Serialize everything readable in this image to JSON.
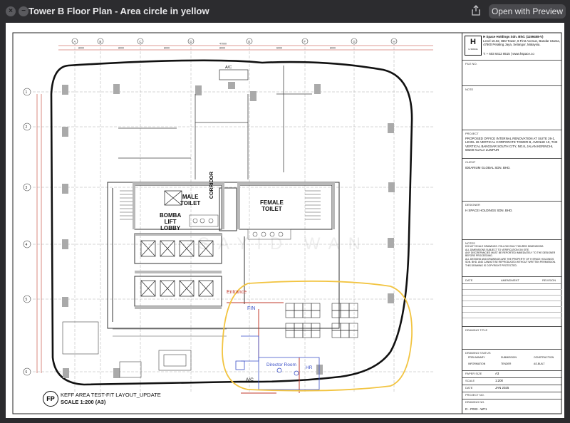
{
  "window": {
    "title": "Tower B Floor Plan - Area circle in yellow",
    "open_button": "Open with Preview"
  },
  "plan": {
    "labels": {
      "male_toilet": "MALE\nTOILET",
      "female_toilet": "FEMALE\nTOILET",
      "corridor": "CORRIDOR",
      "bomba_lift_lobby": "BOMBA\nLIFT\nLOBBY",
      "entrance": "Entrance",
      "fin": "FIN",
      "director_room": "Director Room",
      "hr": "HR",
      "acmu": "A/C",
      "top_acmu": "A/C"
    },
    "grid_rows": [
      "1",
      "2",
      "3",
      "4",
      "5",
      "6"
    ],
    "grid_cols": [
      "A",
      "B",
      "C",
      "D",
      "E",
      "F",
      "G",
      "H"
    ],
    "dims_top": [
      "47000",
      "8000",
      "8000",
      "8000",
      "8000",
      "6000",
      "8000"
    ],
    "highlight_color": "#f2c441",
    "watermark": "SAYID WAN",
    "footer_title": "KEFF AREA TEST-FIT LAYOUT_UPDATE",
    "footer_scale": "SCALE  1:200 (A3)",
    "footer_badge": "FP"
  },
  "title_block": {
    "company": "H Space Holdings Sdn. Bhd. (1159458-V)",
    "address": "Level 16.02, IBM Tower, 8 First Avenue, Bandar Utama, 47800 Petaling Jaya, Selangor, Malaysia.",
    "contact": "T: + 603 6412 8515 | www.hspace.co",
    "logo_text": "H SPACE",
    "file_no_label": "FILE NO.",
    "note_label": "NOTE",
    "project_label": "PROJECT",
    "project_text": "PROPOSED OFFICE INTERNAL RENOVATION AT SUITE 26-1, LEVEL 26 VERTICAL CORPORATE TOWER B, AVENUE 10, THE VERTICAL BANGSAR SOUTH CITY, NO.8, JALAN KERINCHI, 59200 KUALA LUMPUR",
    "client_label": "CLIENT",
    "client_text": "IDEARIUM GLOBAL SDN. BHD.",
    "designer_label": "DESIGNER",
    "designer_text": "H SPACE HOLDINGS SDN. BHD.",
    "notes_label": "NOTES",
    "notes": [
      "DO NOT SCALE DRAWINGS. FOLLOW ONLY FIGURED DIMENSIONS.",
      "ALL DIMENSIONS SUBJECT TO VERIFICATION ON SITE.",
      "ANY DISCREPANCIES MUST BE REPORTED IMMEDIATELY TO THE DESIGNER BEFORE PROCEEDING.",
      "ALL DESIGNS AND DRAWINGS ARE THE PROPERTY OF H SPACE HOLDINGS SDN. BHD. AND CANNOT BE REPRODUCED WITHOUT WRITTEN PERMISSION.",
      "THIS DRAWING IS COPYRIGHT PROTECTED."
    ],
    "rev_headers": [
      "DATE",
      "AMENDMENT",
      "REVISION"
    ],
    "drawing_title_label": "DRAWING TITLE",
    "status_label": "DRAWING STATUS",
    "status_items": [
      "PRELIMINARY",
      "SUBMISSION",
      "CONSTRUCTION",
      "INFORMATION",
      "TENDER",
      "AS-BUILT"
    ],
    "paper_size_label": "PAPER SIZE",
    "paper_size": "A3",
    "scale_label": "SCALE",
    "scale_value": "1:200",
    "date_label": "DATE",
    "date_value": "JAN 2025",
    "project_no_label": "PROJECT NO.",
    "drawing_no_label": "DRAWING NO.",
    "drawing_no": "D - P003 - WF1"
  }
}
